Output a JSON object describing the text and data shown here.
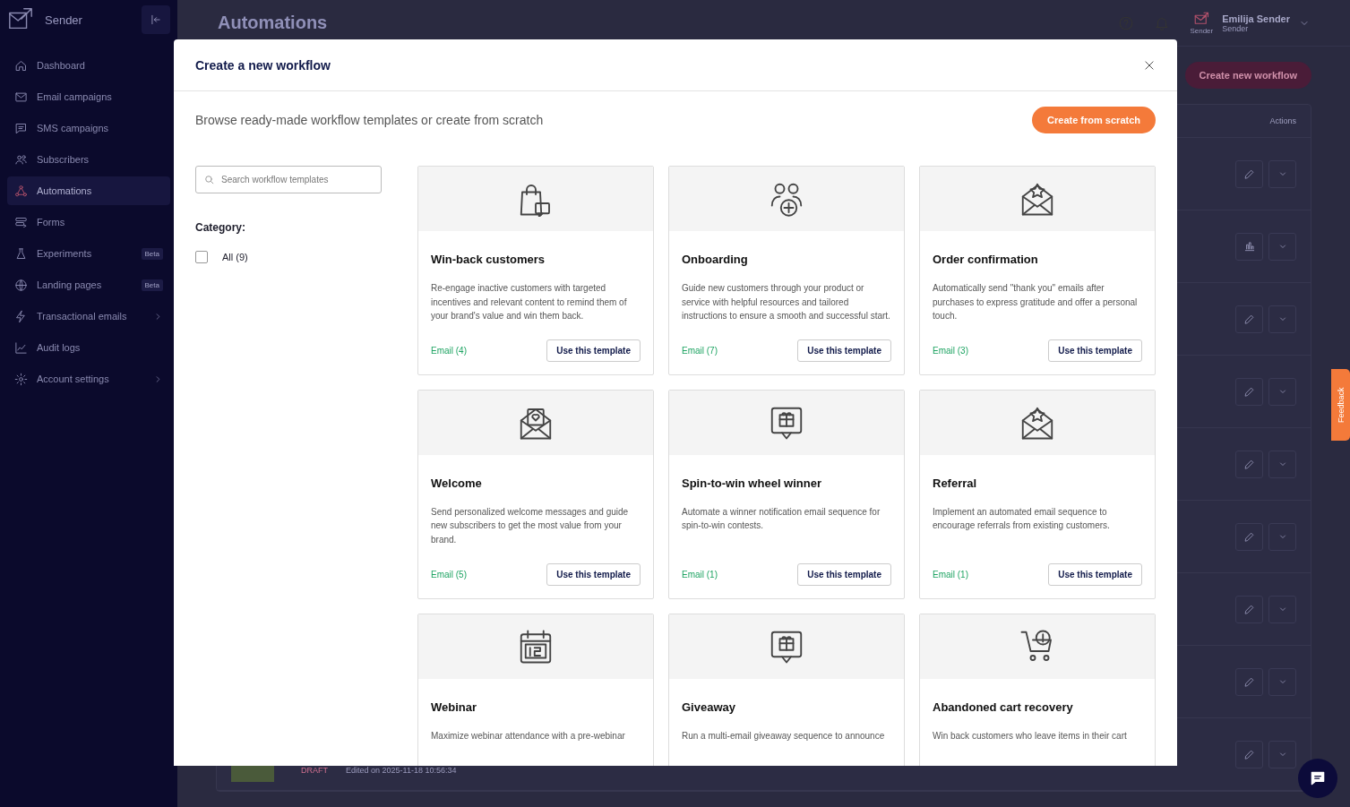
{
  "sidebar": {
    "brand": "Sender",
    "items": [
      {
        "label": "Dashboard",
        "selected": false,
        "expandable": false
      },
      {
        "label": "Email campaigns",
        "selected": false,
        "expandable": false
      },
      {
        "label": "SMS campaigns",
        "selected": false,
        "expandable": false
      },
      {
        "label": "Subscribers",
        "selected": false,
        "expandable": false
      },
      {
        "label": "Automations",
        "selected": true,
        "expandable": false
      },
      {
        "label": "Forms",
        "selected": false,
        "expandable": false
      },
      {
        "label": "Experiments",
        "selected": false,
        "expandable": false,
        "badge": "Beta"
      },
      {
        "label": "Landing pages",
        "selected": false,
        "expandable": false,
        "badge": "Beta"
      },
      {
        "label": "Transactional emails",
        "selected": false,
        "expandable": true
      },
      {
        "label": "Audit logs",
        "selected": false,
        "expandable": false
      },
      {
        "label": "Account settings",
        "selected": false,
        "expandable": true
      }
    ]
  },
  "header": {
    "title": "Automations",
    "user": {
      "name": "Emilija Sender",
      "company": "Sender",
      "logo_caption": "Sender"
    }
  },
  "page": {
    "create_button": "Create new workflow",
    "table": {
      "columns": [
        "Actions"
      ],
      "rows": [
        {
          "kind": "edit"
        },
        {
          "kind": "stats"
        },
        {
          "kind": "edit"
        },
        {
          "kind": "edit"
        },
        {
          "kind": "edit"
        },
        {
          "kind": "edit"
        },
        {
          "kind": "edit"
        },
        {
          "kind": "edit"
        },
        {
          "kind": "edit",
          "status": "DRAFT",
          "edited": "Edited on 2025-11-18 10:56:34"
        }
      ]
    }
  },
  "feedback": "Feedback",
  "modal": {
    "title": "Create a new workflow",
    "subtitle": "Browse ready-made workflow templates or create from scratch",
    "scratch_button": "Create from scratch",
    "search": {
      "placeholder": "Search workflow templates"
    },
    "category": {
      "label": "Category:",
      "options": [
        {
          "label": "All (9)",
          "checked": false
        }
      ]
    },
    "templates": [
      {
        "title": "Win-back customers",
        "description": "Re-engage inactive customers with targeted incentives and relevant content to remind them of your brand's value and win them back.",
        "count": "Email (4)",
        "button": "Use this template"
      },
      {
        "title": "Onboarding",
        "description": "Guide new customers through your product or service with helpful resources and tailored instructions to ensure a smooth and successful start.",
        "count": "Email (7)",
        "button": "Use this template"
      },
      {
        "title": "Order confirmation",
        "description": "Automatically send \"thank you\" emails after purchases to express gratitude and offer a personal touch.",
        "count": "Email (3)",
        "button": "Use this template"
      },
      {
        "title": "Welcome",
        "description": "Send personalized welcome messages and guide new subscribers to get the most value from your brand.",
        "count": "Email (5)",
        "button": "Use this template"
      },
      {
        "title": "Spin-to-win wheel winner",
        "description": "Automate a winner notification email sequence for spin-to-win contests.",
        "count": "Email (1)",
        "button": "Use this template"
      },
      {
        "title": "Referral",
        "description": "Implement an automated email sequence to encourage referrals from existing customers.",
        "count": "Email (1)",
        "button": "Use this template"
      },
      {
        "title": "Webinar",
        "description": "Maximize webinar attendance with a pre-webinar"
      },
      {
        "title": "Giveaway",
        "description": "Run a multi-email giveaway sequence to announce"
      },
      {
        "title": "Abandoned cart recovery",
        "description": "Win back customers who leave items in their cart"
      }
    ]
  }
}
